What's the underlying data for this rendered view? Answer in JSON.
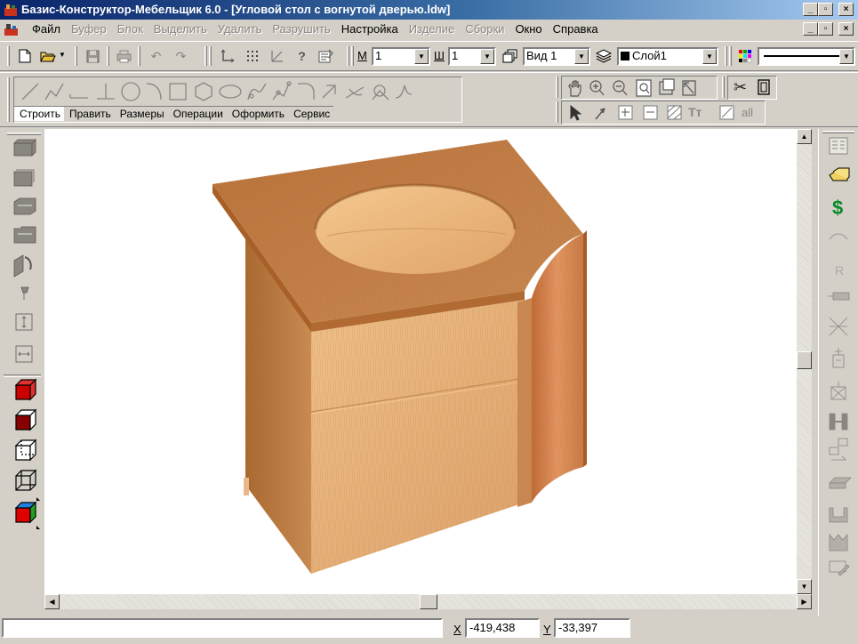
{
  "window": {
    "title": "Базис-Конструктор-Мебельщик 6.0 - [Угловой стол с вогнутой дверью.ldw]",
    "minimize": "_",
    "restore": "▫",
    "close": "×"
  },
  "menu": {
    "items": [
      {
        "label": "Файл",
        "enabled": true
      },
      {
        "label": "Буфер",
        "enabled": false
      },
      {
        "label": "Блок",
        "enabled": false
      },
      {
        "label": "Выделить",
        "enabled": false
      },
      {
        "label": "Удалить",
        "enabled": false
      },
      {
        "label": "Разрушить",
        "enabled": false
      },
      {
        "label": "Настройка",
        "enabled": true
      },
      {
        "label": "Изделие",
        "enabled": false
      },
      {
        "label": "Сборки",
        "enabled": false
      },
      {
        "label": "Окно",
        "enabled": true
      },
      {
        "label": "Справка",
        "enabled": true
      }
    ]
  },
  "toolbar": {
    "m_label": "М",
    "m_value": "1",
    "w_label": "Ш",
    "w_value": "1",
    "view_value": "Вид 1",
    "layer_value": "Слой1",
    "all_label": "all"
  },
  "tabs": [
    {
      "label": "Строить",
      "active": true
    },
    {
      "label": "Править",
      "active": false
    },
    {
      "label": "Размеры",
      "active": false
    },
    {
      "label": "Операции",
      "active": false
    },
    {
      "label": "Оформить",
      "active": false
    },
    {
      "label": "Сервис",
      "active": false
    }
  ],
  "status": {
    "x_label": "X",
    "x_value": "-419,438",
    "y_label": "Y",
    "y_value": "-33,397"
  },
  "colors": {
    "titlebar_start": "#0a246a",
    "titlebar_end": "#a6caf0",
    "wood_top": "#c07a3c",
    "wood_front": "#e8b07a",
    "wood_side": "#b06e38",
    "wood_door": "#d6824c"
  },
  "icons": {
    "dollar": "$",
    "text_tool": "Tт",
    "r_tool": "R"
  }
}
